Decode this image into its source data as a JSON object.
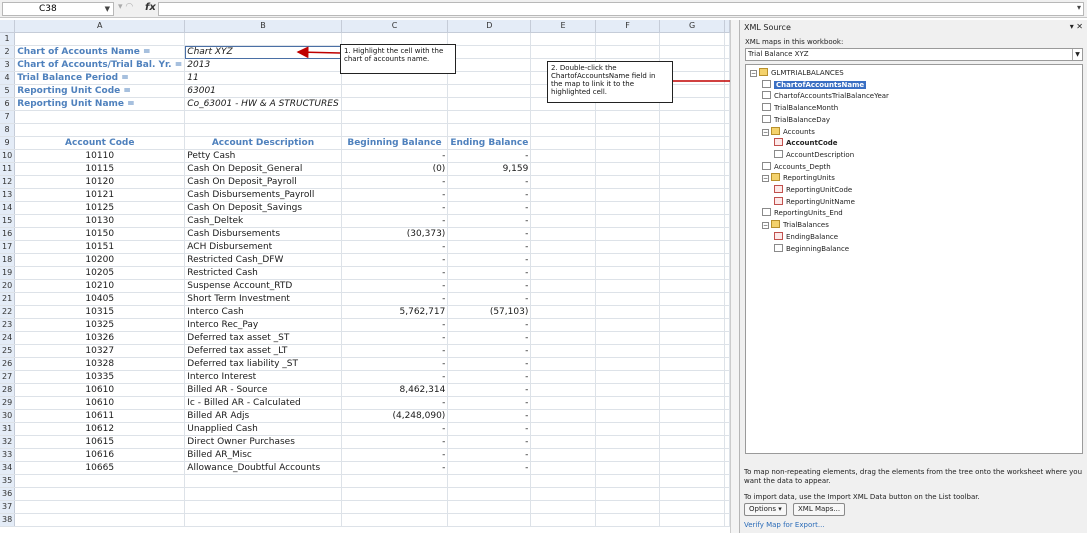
{
  "formula": {
    "cell_ref": "C38",
    "fx": "fx"
  },
  "columns": [
    "A",
    "B",
    "C",
    "D",
    "E",
    "F",
    "G"
  ],
  "row_numbers": [
    "1",
    "2",
    "3",
    "4",
    "5",
    "6",
    "7",
    "8",
    "9",
    "10",
    "11",
    "12",
    "13",
    "14",
    "15",
    "16",
    "17",
    "18",
    "19",
    "20",
    "21",
    "22",
    "23",
    "24",
    "25",
    "26",
    "27",
    "28",
    "29",
    "30",
    "31",
    "32",
    "33",
    "34",
    "35",
    "36",
    "37",
    "38"
  ],
  "header_fields": [
    {
      "label": "Chart of Accounts Name =",
      "value": "Chart XYZ"
    },
    {
      "label": "Chart of Accounts/Trial Bal. Yr. =",
      "value": "2013"
    },
    {
      "label": "Trial Balance Period =",
      "value": "11"
    },
    {
      "label": "Reporting Unit Code =",
      "value": "63001"
    },
    {
      "label": "Reporting Unit Name =",
      "value": "Co_63001 - HW & A STRUCTURES"
    }
  ],
  "table_headers": [
    "Account Code",
    "Account Description",
    "Beginning Balance",
    "Ending Balance"
  ],
  "rows": [
    [
      "10110",
      "Petty Cash",
      "-",
      "-"
    ],
    [
      "10115",
      "Cash On Deposit_General",
      "(0)",
      "9,159"
    ],
    [
      "10120",
      "Cash On Deposit_Payroll",
      "-",
      "-"
    ],
    [
      "10121",
      "Cash Disbursements_Payroll",
      "-",
      "-"
    ],
    [
      "10125",
      "Cash On Deposit_Savings",
      "-",
      "-"
    ],
    [
      "10130",
      "Cash_Deltek",
      "-",
      "-"
    ],
    [
      "10150",
      "Cash Disbursements",
      "(30,373)",
      "-"
    ],
    [
      "10151",
      "ACH Disbursement",
      "-",
      "-"
    ],
    [
      "10200",
      "Restricted Cash_DFW",
      "-",
      "-"
    ],
    [
      "10205",
      "Restricted Cash",
      "-",
      "-"
    ],
    [
      "10210",
      "Suspense Account_RTD",
      "-",
      "-"
    ],
    [
      "10405",
      "Short Term Investment",
      "-",
      "-"
    ],
    [
      "10315",
      "Interco Cash",
      "5,762,717",
      "(57,103)"
    ],
    [
      "10325",
      "Interco Rec_Pay",
      "-",
      "-"
    ],
    [
      "10326",
      "Deferred tax asset _ST",
      "-",
      "-"
    ],
    [
      "10327",
      "Deferred tax asset _LT",
      "-",
      "-"
    ],
    [
      "10328",
      "Deferred tax liability _ST",
      "-",
      "-"
    ],
    [
      "10335",
      "Interco Interest",
      "-",
      "-"
    ],
    [
      "10610",
      "Billed AR - Source",
      "8,462,314",
      "-"
    ],
    [
      "10610",
      "Ic - Billed AR - Calculated",
      "-",
      "-"
    ],
    [
      "10611",
      "Billed AR Adjs",
      "(4,248,090)",
      "-"
    ],
    [
      "10612",
      "Unapplied Cash",
      "-",
      "-"
    ],
    [
      "10615",
      "Direct Owner Purchases",
      "-",
      "-"
    ],
    [
      "10616",
      "Billed AR_Misc",
      "-",
      "-"
    ],
    [
      "10665",
      "Allowance_Doubtful Accounts",
      "-",
      "-"
    ]
  ],
  "callouts": {
    "c1": "1. Highlight the cell with the chart of accounts name.",
    "c2": "2. Double-click the ChartofAccountsName field in the map to link it to the highlighted cell."
  },
  "xml_pane": {
    "title": "XML Source",
    "maps_label": "XML maps in this workbook:",
    "map_selected": "Trial Balance XYZ",
    "tree": [
      {
        "label": "GLMTRIALBALANCES",
        "level": 0,
        "icon": "folder-icon"
      },
      {
        "label": "ChartofAccountsName",
        "level": 1,
        "icon": "field-icon",
        "highlighted": true
      },
      {
        "label": "ChartofAccountsTrialBalanceYear",
        "level": 1,
        "icon": "field-icon"
      },
      {
        "label": "TrialBalanceMonth",
        "level": 1,
        "icon": "field-icon"
      },
      {
        "label": "TrialBalanceDay",
        "level": 1,
        "icon": "field-icon"
      },
      {
        "label": "Accounts",
        "level": 1,
        "icon": "folder-icon"
      },
      {
        "label": "AccountCode",
        "level": 2,
        "icon": "mapped-field-icon",
        "bold": true
      },
      {
        "label": "AccountDescription",
        "level": 2,
        "icon": "field-icon"
      },
      {
        "label": "Accounts_Depth",
        "level": 1,
        "icon": "field-icon"
      },
      {
        "label": "ReportingUnits",
        "level": 1,
        "icon": "folder-icon"
      },
      {
        "label": "ReportingUnitCode",
        "level": 2,
        "icon": "mapped-field-icon"
      },
      {
        "label": "ReportingUnitName",
        "level": 2,
        "icon": "mapped-field-icon"
      },
      {
        "label": "ReportingUnits_End",
        "level": 1,
        "icon": "field-icon"
      },
      {
        "label": "TrialBalances",
        "level": 1,
        "icon": "folder-icon"
      },
      {
        "label": "EndingBalance",
        "level": 2,
        "icon": "mapped-field-icon"
      },
      {
        "label": "BeginningBalance",
        "level": 2,
        "icon": "field-icon"
      }
    ],
    "note1": "To map non-repeating elements, drag the elements from the tree onto the worksheet where you want the data to appear.",
    "note2": "To import data, use the Import XML Data button on the List toolbar.",
    "options_label": "Options",
    "xmlmaps_label": "XML Maps...",
    "verify_label": "Verify Map for Export..."
  },
  "colors": {
    "label_blue": "#4f81bd",
    "arrow_red": "#c00000",
    "highlight": "#3a6fc3"
  }
}
